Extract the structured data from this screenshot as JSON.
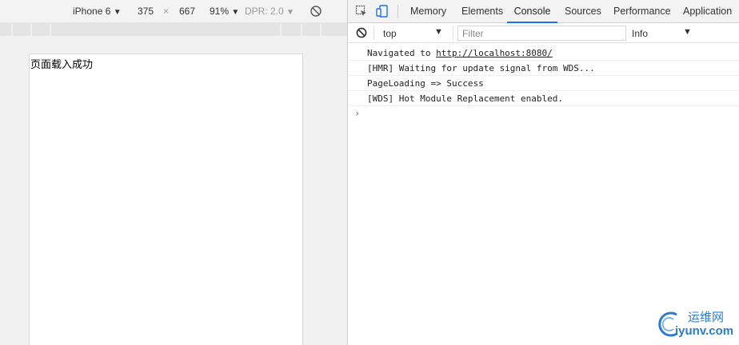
{
  "device_toolbar": {
    "device": "iPhone 6",
    "width": "375",
    "times": "×",
    "height": "667",
    "zoom": "91%",
    "dpr": "DPR: 2.0"
  },
  "viewport": {
    "text": "页面载入成功"
  },
  "devtools": {
    "tabs": [
      "Memory",
      "Elements",
      "Console",
      "Sources",
      "Performance",
      "Application"
    ],
    "active_tab": "Console",
    "context": "top",
    "filter_placeholder": "Filter",
    "level": "Info",
    "log_lines": [
      {
        "prefix": "Navigated to ",
        "link": "http://localhost:8080/"
      },
      {
        "text": "[HMR] Waiting for update signal from WDS..."
      },
      {
        "text": "PageLoading => Success"
      },
      {
        "text": "[WDS] Hot Module Replacement enabled."
      }
    ],
    "prompt": "›"
  },
  "watermark": {
    "cn": "运维网",
    "en": "iyunv.com"
  },
  "colors": {
    "accent": "#1a73e8",
    "prompt": "#367cf1",
    "watermark": "#2b7bd0"
  }
}
